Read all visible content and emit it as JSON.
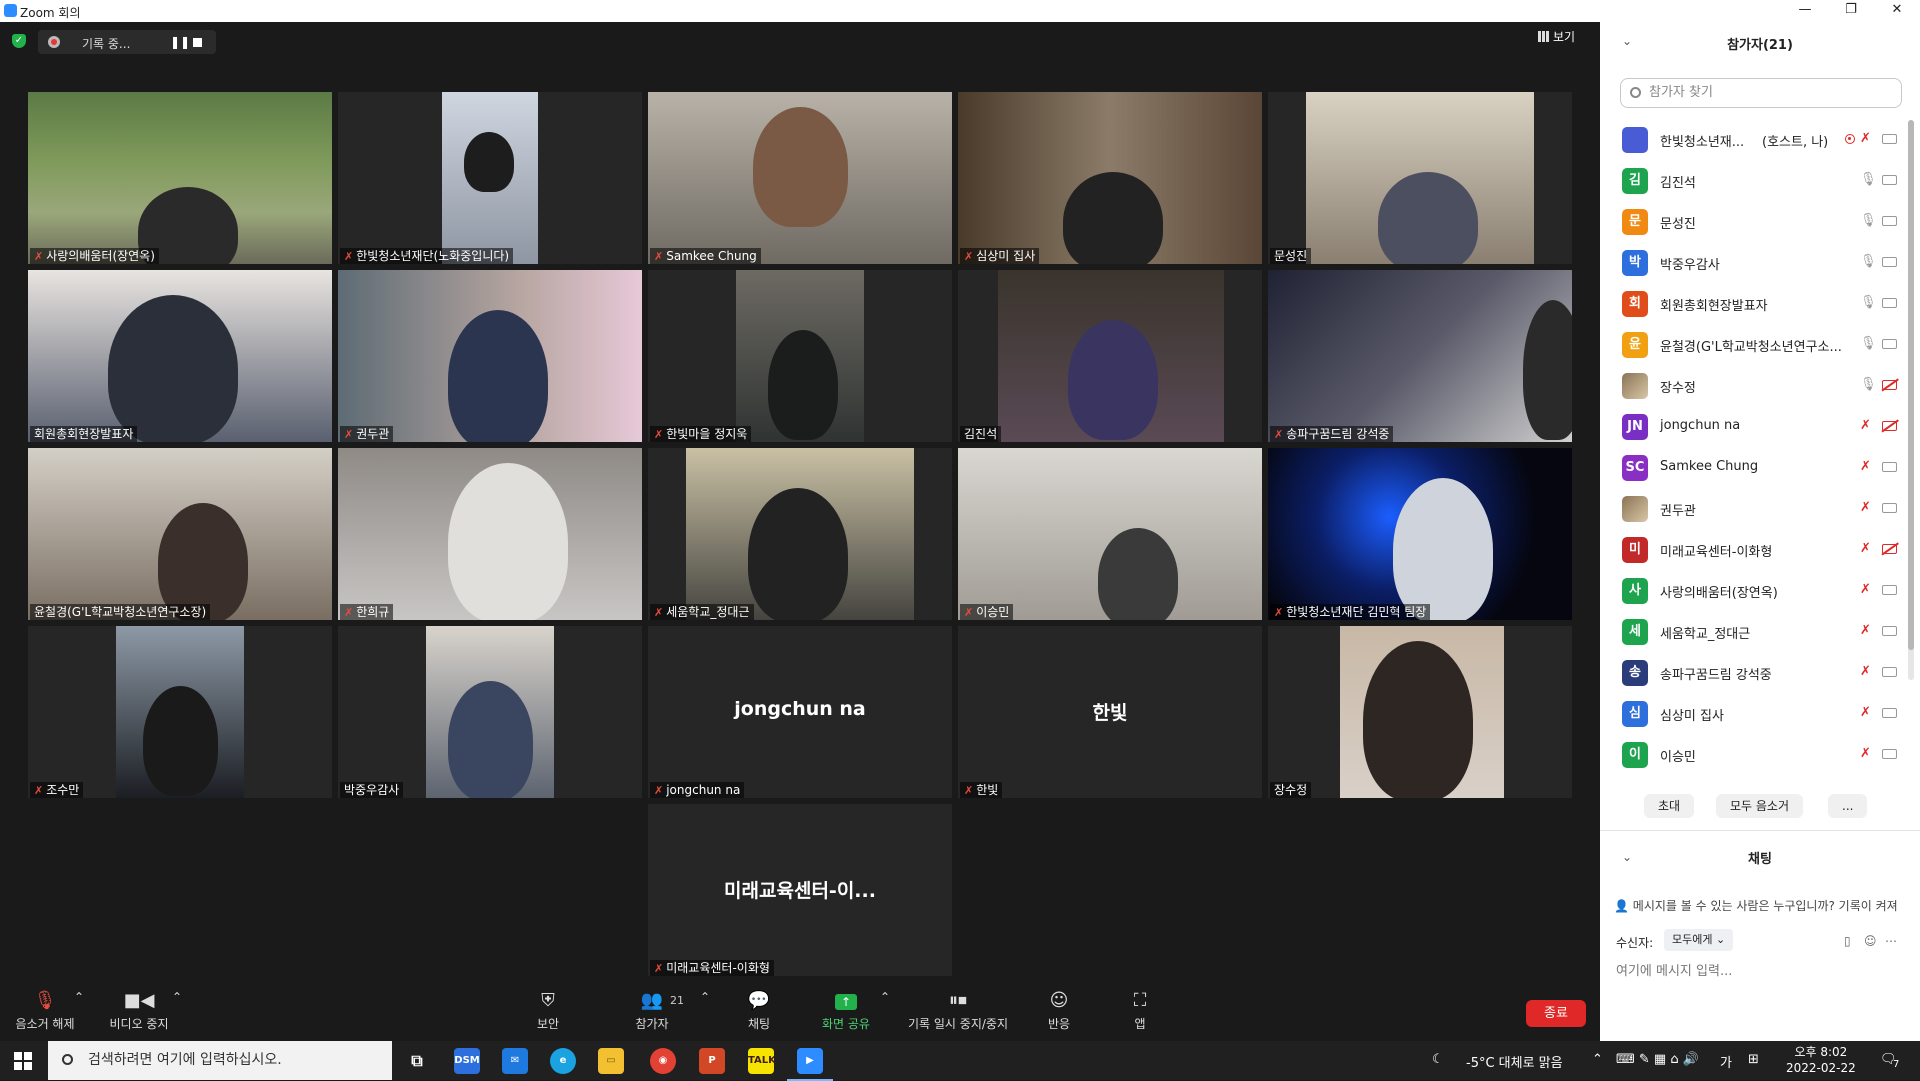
{
  "window": {
    "title": "Zoom 회의",
    "controls": [
      "—",
      "❐",
      "✕"
    ]
  },
  "topbar": {
    "recording_label": "기록 중...",
    "pause_glyph": "❚❚",
    "view_label": "보기"
  },
  "tiles": [
    {
      "name": "사랑의배움터(장연옥)",
      "muted": true
    },
    {
      "name": "한빛청소년재단(노화중입니다)",
      "muted": true
    },
    {
      "name": "Samkee Chung",
      "muted": true
    },
    {
      "name": "심상미 집사",
      "muted": true
    },
    {
      "name": "문성진",
      "muted": false
    },
    {
      "name": "회원총회현장발표자",
      "muted": false
    },
    {
      "name": "권두관",
      "muted": true
    },
    {
      "name": "한빛마을 정지욱",
      "muted": true
    },
    {
      "name": "김진석",
      "muted": false
    },
    {
      "name": "송파구꿈드림 강석중",
      "muted": true
    },
    {
      "name": "윤철경(G'L학교박청소년연구소장)",
      "muted": false
    },
    {
      "name": "한희규",
      "muted": true
    },
    {
      "name": "세움학교_정대근",
      "muted": true
    },
    {
      "name": "이승민",
      "muted": true
    },
    {
      "name": "한빛청소년재단 김민혁 팀장",
      "muted": true
    },
    {
      "name": "조수만",
      "muted": true
    },
    {
      "name": "박중우감사",
      "muted": false
    },
    {
      "name": "jongchun na",
      "muted": true,
      "center": "jongchun na"
    },
    {
      "name": "한빛",
      "muted": true,
      "center": "한빛"
    },
    {
      "name": "장수정",
      "muted": false
    },
    {
      "name": "미래교육센터-이화형",
      "muted": true,
      "center": "미래교육센터-이..."
    }
  ],
  "toolbar": {
    "unmute": "음소거 해제",
    "stop_video": "비디오 중지",
    "security": "보안",
    "participants": "참가자",
    "participants_count": "21",
    "chat": "채팅",
    "share": "화면 공유",
    "record_pause": "기록 일시 중지/중지",
    "reactions": "반응",
    "apps": "앱",
    "end": "종료"
  },
  "panel": {
    "title": "참가자(21)",
    "search_placeholder": "참가자 찾기",
    "participants": [
      {
        "avatar": "",
        "color": "#4a5bd6",
        "name": "한빛청소년재...",
        "tag": "(호스트, 나)",
        "mic_off": true,
        "cam_off": false,
        "recording": true
      },
      {
        "avatar": "김",
        "color": "#1ea34f",
        "name": "김진석",
        "mic_off": false,
        "cam_off": false
      },
      {
        "avatar": "문",
        "color": "#f08a12",
        "name": "문성진",
        "mic_off": false,
        "cam_off": false
      },
      {
        "avatar": "박",
        "color": "#2d6fdc",
        "name": "박중우감사",
        "mic_off": false,
        "cam_off": false
      },
      {
        "avatar": "회",
        "color": "#e04d1a",
        "name": "회원총회현장발표자",
        "mic_off": false,
        "cam_off": false
      },
      {
        "avatar": "윤",
        "color": "#f0a010",
        "name": "윤철경(G'L학교박청소년연구소...",
        "mic_off": false,
        "cam_off": false
      },
      {
        "avatar": "",
        "color": "img",
        "name": "장수정",
        "mic_off": false,
        "cam_off": true
      },
      {
        "avatar": "JN",
        "color": "#7a2fc4",
        "name": "jongchun na",
        "mic_off": true,
        "cam_off": true
      },
      {
        "avatar": "SC",
        "color": "#8a2fc4",
        "name": "Samkee Chung",
        "mic_off": true,
        "cam_off": false
      },
      {
        "avatar": "",
        "color": "img",
        "name": "권두관",
        "mic_off": true,
        "cam_off": false
      },
      {
        "avatar": "미",
        "color": "#c22a2a",
        "name": "미래교육센터-이화형",
        "mic_off": true,
        "cam_off": true
      },
      {
        "avatar": "사",
        "color": "#1ea34f",
        "name": "사랑의배움터(장연옥)",
        "mic_off": true,
        "cam_off": false
      },
      {
        "avatar": "세",
        "color": "#1ea34f",
        "name": "세움학교_정대근",
        "mic_off": true,
        "cam_off": false
      },
      {
        "avatar": "송",
        "color": "#2a3d7a",
        "name": "송파구꿈드림 강석중",
        "mic_off": true,
        "cam_off": false
      },
      {
        "avatar": "심",
        "color": "#2d6fdc",
        "name": "심상미 집사",
        "mic_off": true,
        "cam_off": false
      },
      {
        "avatar": "이",
        "color": "#1ea34f",
        "name": "이승민",
        "mic_off": true,
        "cam_off": false
      }
    ],
    "invite": "초대",
    "mute_all": "모두 음소거",
    "more": "...",
    "chat_title": "채팅",
    "chat_info": "메시지를 볼 수 있는 사람은 누구입니까? 기록이 켜져",
    "recipient_label": "수신자:",
    "recipient_value": "모두에게 ⌄",
    "chat_placeholder": "여기에 메시지 입력..."
  },
  "taskbar": {
    "search_placeholder": "검색하려면 여기에 입력하십시오.",
    "weather": "-5°C 대체로 맑음",
    "ime": "가",
    "time": "오후 8:02",
    "date": "2022-02-22",
    "notifications": "7"
  }
}
